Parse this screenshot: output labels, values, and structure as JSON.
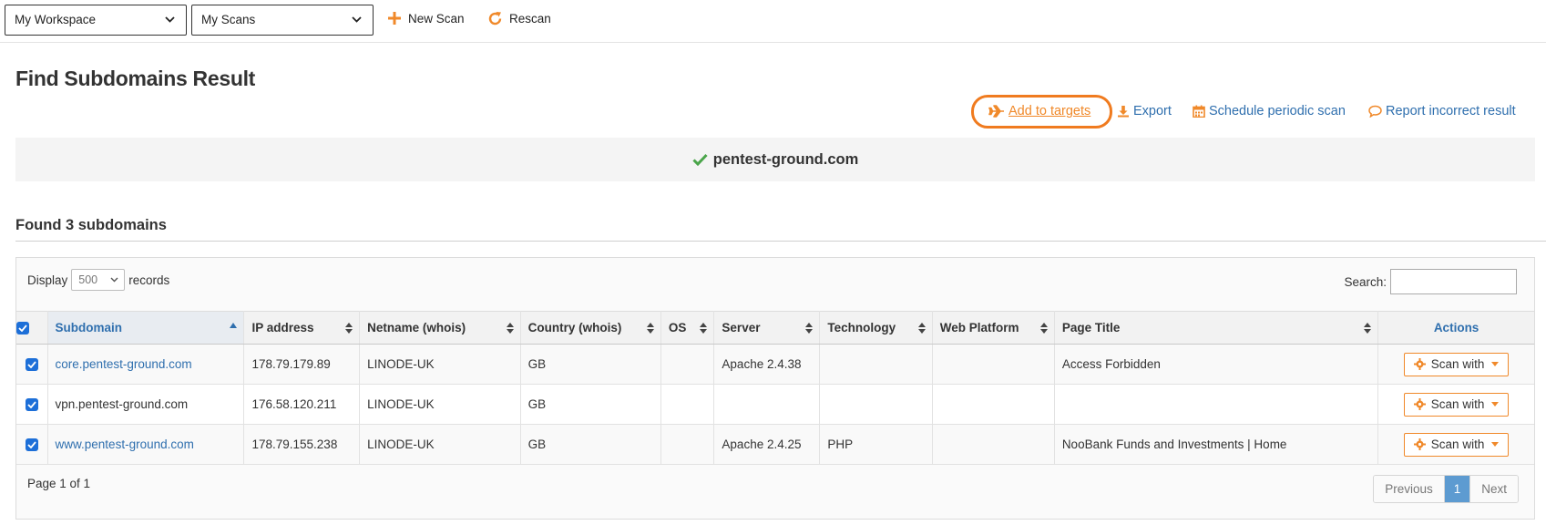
{
  "toolbar": {
    "workspace_select": "My Workspace",
    "scans_select": "My Scans",
    "new_scan_label": "New Scan",
    "rescan_label": "Rescan"
  },
  "page": {
    "title": "Find Subdomains Result"
  },
  "actions": {
    "add_to_targets": " Add to targets",
    "export": "Export",
    "schedule": "Schedule periodic scan",
    "report": "Report incorrect result"
  },
  "banner": {
    "domain": "pentest-ground.com"
  },
  "results": {
    "found_label": "Found 3 subdomains"
  },
  "table_controls": {
    "display_label": "Display",
    "records_label": "records",
    "records_value": "500",
    "search_label": "Search:"
  },
  "columns": [
    "Subdomain",
    "IP address",
    "Netname (whois)",
    "Country (whois)",
    "OS",
    "Server",
    "Technology",
    "Web Platform",
    "Page Title",
    "Actions"
  ],
  "rows": [
    {
      "subdomain": "core.pentest-ground.com",
      "ip": "178.79.179.89",
      "netname": "LINODE-UK",
      "country": "GB",
      "os": "",
      "server": "Apache 2.4.38",
      "technology": "",
      "platform": "",
      "title": "Access Forbidden",
      "action": "Scan with"
    },
    {
      "subdomain": "vpn.pentest-ground.com",
      "ip": "176.58.120.211",
      "netname": "LINODE-UK",
      "country": "GB",
      "os": "",
      "server": "",
      "technology": "",
      "platform": "",
      "title": "",
      "action": "Scan with"
    },
    {
      "subdomain": "www.pentest-ground.com",
      "ip": "178.79.155.238",
      "netname": "LINODE-UK",
      "country": "GB",
      "os": "",
      "server": "Apache 2.4.25",
      "technology": "PHP",
      "platform": "",
      "title": "NooBank Funds and Investments | Home",
      "action": "Scan with"
    }
  ],
  "pagination": {
    "page_info": "Page 1 of 1",
    "previous": "Previous",
    "current": "1",
    "next": "Next"
  },
  "colors": {
    "accent": "#f0892a",
    "link": "#2f6fae",
    "success": "#4aa54a",
    "highlight_ring": "#f07b1f"
  }
}
